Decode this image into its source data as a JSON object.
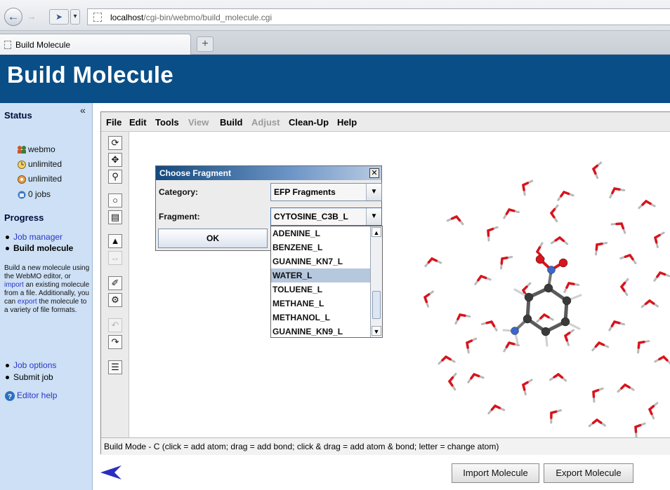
{
  "browser": {
    "url_host": "localhost",
    "url_path": "/cgi-bin/webmo/build_molecule.cgi",
    "tab_title": "Build Molecule",
    "new_tab_label": "+"
  },
  "page": {
    "title": "Build Molecule"
  },
  "sidebar": {
    "status_title": "Status",
    "collapse_glyph": "«",
    "status_items": [
      {
        "text": "webmo",
        "icon": "users-icon"
      },
      {
        "text": "unlimited",
        "icon": "clock-icon"
      },
      {
        "text": "unlimited",
        "icon": "quota-icon"
      },
      {
        "text": "0 jobs",
        "icon": "jobs-icon"
      }
    ],
    "progress_title": "Progress",
    "progress_items": [
      {
        "text": "Job manager",
        "link": true
      },
      {
        "text": "Build molecule",
        "link": false
      }
    ],
    "help": {
      "part1": "Build a new molecule using the WebMO editor, or ",
      "import_link": "import",
      "part2": " an existing molecule from a file. Additionally, you can ",
      "export_link": "export",
      "part3": " the molecule to a variety of file formats."
    },
    "next_items": [
      {
        "text": "Job options",
        "link": true
      },
      {
        "text": "Submit job",
        "link": false
      }
    ],
    "editor_help": "Editor help"
  },
  "editor": {
    "menus": [
      {
        "label": "File",
        "enabled": true
      },
      {
        "label": "Edit",
        "enabled": true
      },
      {
        "label": "Tools",
        "enabled": true
      },
      {
        "label": "View",
        "enabled": false
      },
      {
        "label": "Build",
        "enabled": true
      },
      {
        "label": "Adjust",
        "enabled": false
      },
      {
        "label": "Clean-Up",
        "enabled": true
      },
      {
        "label": "Help",
        "enabled": true
      }
    ],
    "status_line": "Build Mode - C (click = add atom; drag = add bond; click & drag = add atom & bond; letter = change atom)",
    "atom_colors": {
      "carbon": "#3a3a3a",
      "oxygen": "#d8141c",
      "nitrogen": "#3a67c9",
      "hydrogen": "#e4e4e4"
    }
  },
  "dialog": {
    "title": "Choose Fragment",
    "close_glyph": "✕",
    "category_label": "Category:",
    "category_value": "EFP Fragments",
    "fragment_label": "Fragment:",
    "fragment_value": "CYTOSINE_C3B_L",
    "ok_label": "OK",
    "options": [
      "ADENINE_L",
      "BENZENE_L",
      "GUANINE_KN7_L",
      "WATER_L",
      "TOLUENE_L",
      "METHANE_L",
      "METHANOL_L",
      "GUANINE_KN9_L"
    ],
    "highlighted_option": "WATER_L"
  },
  "buttons": {
    "import": "Import Molecule",
    "export": "Export Molecule"
  }
}
